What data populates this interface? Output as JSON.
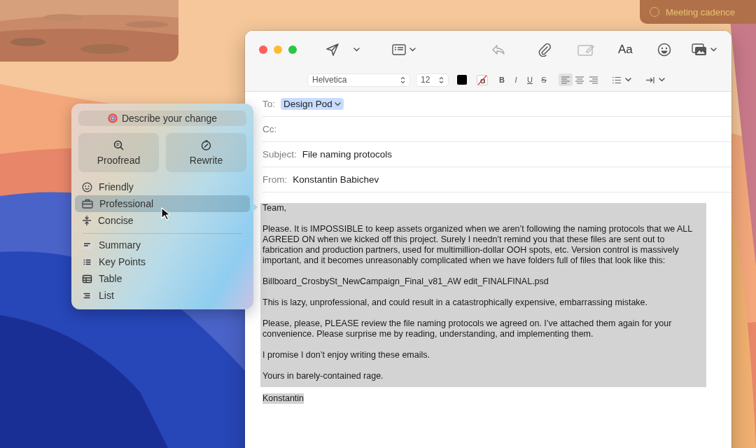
{
  "desktop": {
    "widget": {
      "label": "Meeting cadence",
      "checked": false
    }
  },
  "compose": {
    "toolbar": {
      "font_label": "Aa"
    },
    "format_bar": {
      "font": "Helvetica",
      "size": "12",
      "styles": [
        {
          "label": "B",
          "kind": "bold"
        },
        {
          "label": "I",
          "kind": "italic"
        },
        {
          "label": "U",
          "kind": "underline"
        },
        {
          "label": "S",
          "kind": "strike"
        }
      ],
      "alignments": [
        {
          "selected": true
        },
        {
          "selected": false
        },
        {
          "selected": false
        }
      ]
    },
    "headers": [
      {
        "label": "To:",
        "chip": "Design Pod"
      },
      {
        "label": "Cc:"
      },
      {
        "label": "Subject:",
        "value": "File naming protocols"
      },
      {
        "label": "From:",
        "value": "Konstantin Babichev"
      }
    ],
    "body": {
      "selected": true,
      "paragraphs": [
        "Team,",
        "Please. It is IMPOSSIBLE to keep assets organized when we aren’t following the naming protocols that we ALL AGREED ON when we kicked off this project. Surely I needn’t remind you that these files are sent out to fabrication and production partners, used for multimillion-dollar OOH spots, etc. Version control is massively important, and it becomes unreasonably complicated when we have folders full of files that look like this:",
        "Billboard_CrosbySt_NewCampaign_Final_v81_AW edit_FINALFINAL.psd",
        "This is lazy, unprofessional, and could result in a catastrophically expensive, embarrassing mistake.",
        "Please, please, PLEASE review the file naming protocols we agreed on. I’ve attached them again for your convenience. Please surprise me by reading, understanding, and implementing them.",
        "I promise I don’t enjoy writing these emails.",
        "Yours in barely-contained rage."
      ],
      "signature": "Konstantin"
    }
  },
  "writing_tools": {
    "prompt": "Describe your change",
    "actions": [
      "Proofread",
      "Rewrite"
    ],
    "tones": [
      {
        "label": "Friendly",
        "selected": false
      },
      {
        "label": "Professional",
        "selected": true
      },
      {
        "label": "Concise",
        "selected": false
      }
    ],
    "formats": [
      {
        "label": "Summary",
        "selected": false
      },
      {
        "label": "Key Points",
        "selected": false
      },
      {
        "label": "Table",
        "selected": false
      },
      {
        "label": "List",
        "selected": false
      }
    ]
  }
}
